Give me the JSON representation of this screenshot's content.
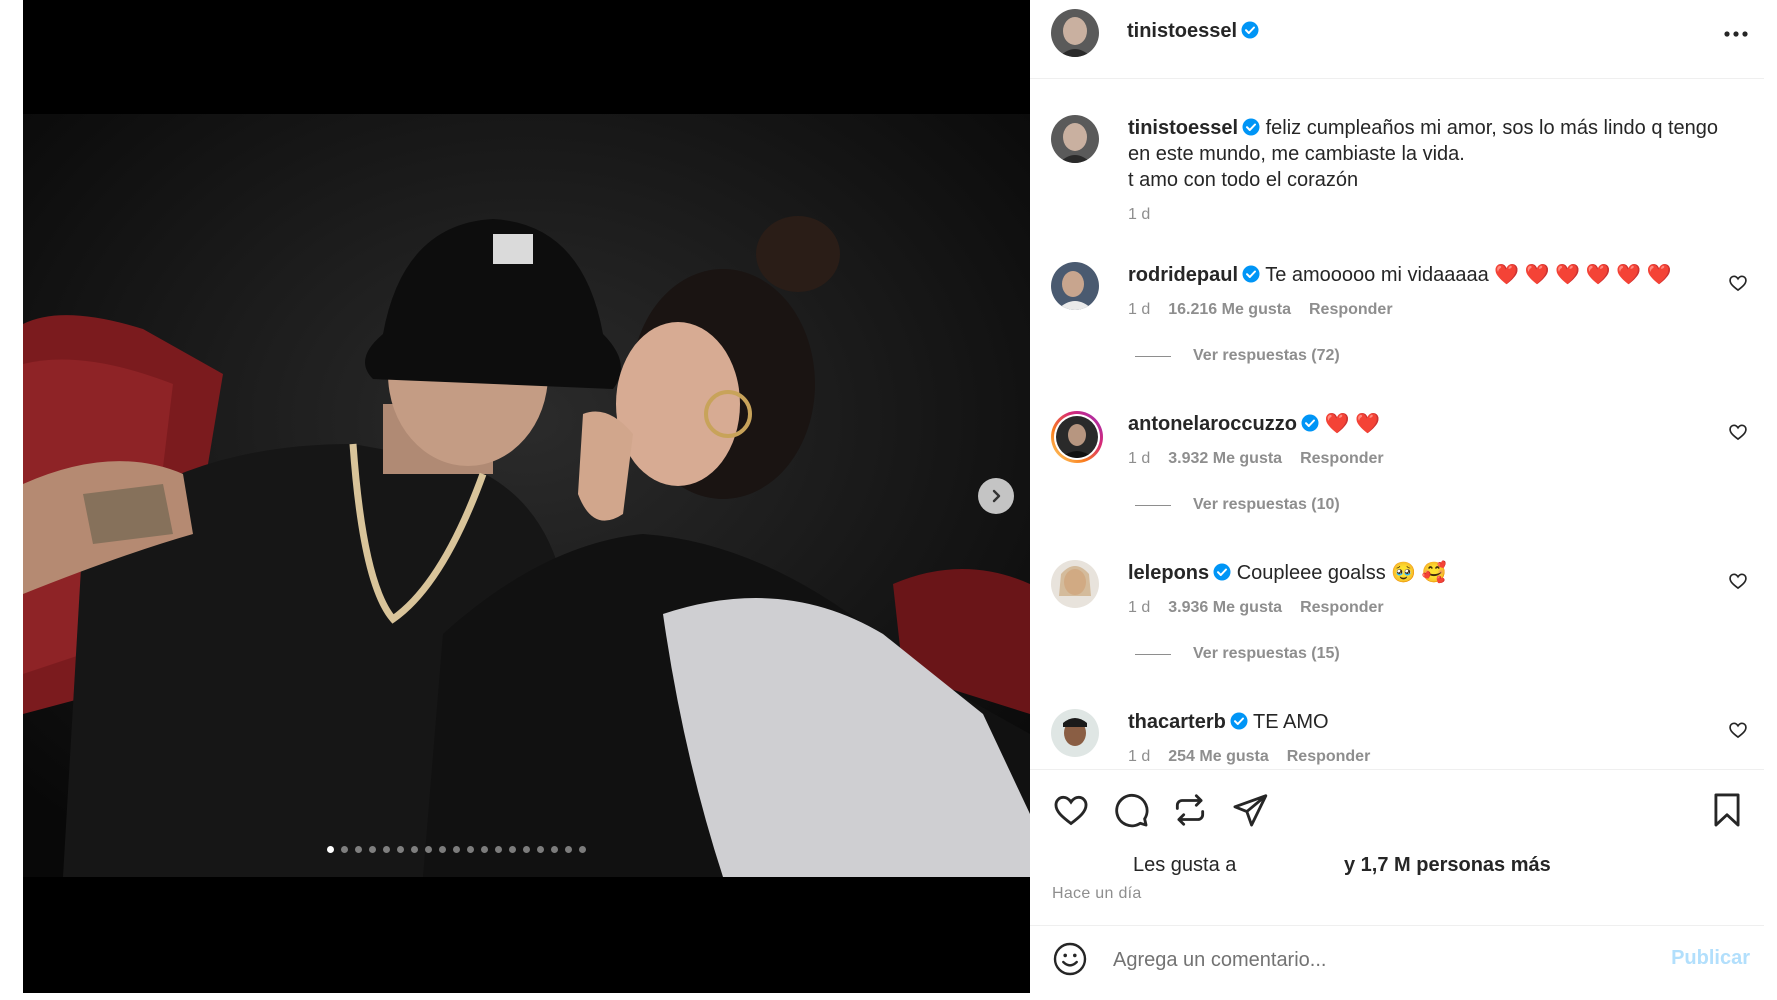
{
  "post": {
    "author": "tinistoessel",
    "options_icon": "more-horizontal-icon",
    "media": {
      "slide_count": 19,
      "active_slide": 1,
      "next_icon": "chevron-right-icon"
    }
  },
  "caption": {
    "username": "tinistoessel",
    "lines": [
      "feliz cumpleaños mi amor, sos lo más lindo q tengo",
      "en este mundo, me cambiaste la vida.",
      "t amo con todo el corazón"
    ],
    "time": "1 d"
  },
  "comments": [
    {
      "username": "rodridepaul",
      "text": "Te amooooo mi vidaaaaa ❤️ ❤️ ❤️ ❤️ ❤️ ❤️",
      "time": "1 d",
      "likes": "16.216 Me gusta",
      "reply": "Responder",
      "view_replies": "Ver respuestas (72)"
    },
    {
      "username": "antonelaroccuzzo",
      "text": "❤️ ❤️",
      "time": "1 d",
      "likes": "3.932 Me gusta",
      "reply": "Responder",
      "view_replies": "Ver respuestas (10)"
    },
    {
      "username": "lelepons",
      "text": "Coupleee goalss 🥹 🥰",
      "time": "1 d",
      "likes": "3.936 Me gusta",
      "reply": "Responder",
      "view_replies": "Ver respuestas (15)"
    },
    {
      "username": "thacarterb",
      "text": "TE AMO",
      "time": "1 d",
      "likes": "254 Me gusta",
      "reply": "Responder"
    }
  ],
  "actions": {
    "like_icon": "heart-icon",
    "comment_icon": "comment-icon",
    "repost_icon": "repost-icon",
    "share_icon": "share-icon",
    "save_icon": "bookmark-icon"
  },
  "likes": {
    "prefix": "Les gusta a",
    "suffix": "y 1,7 M personas más"
  },
  "posted": "Hace un día",
  "composer": {
    "emoji_icon": "emoji-icon",
    "placeholder": "Agrega un comentario...",
    "publish_label": "Publicar"
  },
  "colors": {
    "verified": "#0095f6",
    "muted_text": "#8e8e8e",
    "publish_disabled": "#b2dffc",
    "story_ring": "#d6249f"
  }
}
